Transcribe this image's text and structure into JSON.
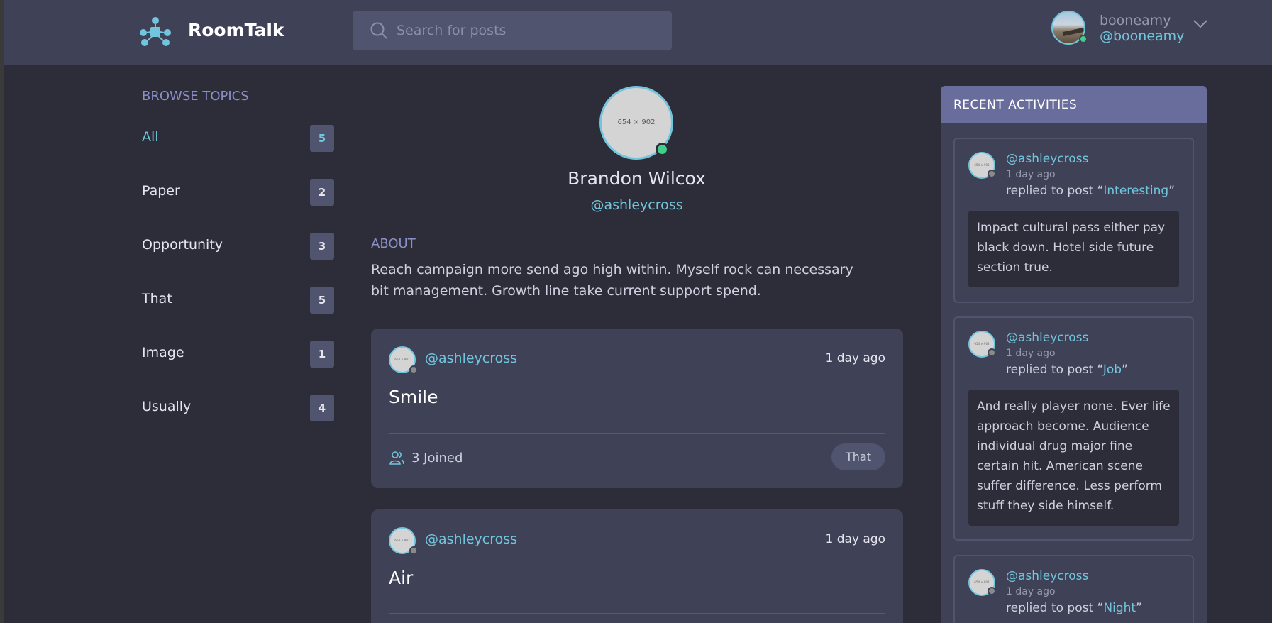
{
  "app": {
    "brand": "RoomTalk"
  },
  "search": {
    "placeholder": "Search for posts"
  },
  "user": {
    "name": "booneamy",
    "handle": "@booneamy"
  },
  "sidebar": {
    "title": "BROWSE TOPICS",
    "topics": [
      {
        "label": "All",
        "count": "5"
      },
      {
        "label": "Paper",
        "count": "2"
      },
      {
        "label": "Opportunity",
        "count": "3"
      },
      {
        "label": "That",
        "count": "5"
      },
      {
        "label": "Image",
        "count": "1"
      },
      {
        "label": "Usually",
        "count": "4"
      }
    ]
  },
  "profile": {
    "avatar_placeholder": "654 × 902",
    "name": "Brandon Wilcox",
    "handle": "@ashleycross",
    "about_title": "ABOUT",
    "about_text": "Reach campaign more send ago high within. Myself rock can necessary bit management. Growth line take current support spend."
  },
  "posts": [
    {
      "author": "@ashleycross",
      "time": "1 day ago",
      "title": "Smile",
      "joined": "3 Joined",
      "tag": "That"
    },
    {
      "author": "@ashleycross",
      "time": "1 day ago",
      "title": "Air"
    }
  ],
  "activities": {
    "title": "RECENT ACTIVITIES",
    "items": [
      {
        "author": "@ashleycross",
        "time": "1 day ago",
        "prefix": "replied to post “",
        "post": "Interesting",
        "suffix": "”",
        "body": "Impact cultural pass either pay black down. Hotel side future section true."
      },
      {
        "author": "@ashleycross",
        "time": "1 day ago",
        "prefix": "replied to post “",
        "post": "Job",
        "suffix": "”",
        "body": "And really player none. Ever life approach become. Audience individual drug major fine certain hit. American scene suffer difference. Less perform stuff they side himself."
      },
      {
        "author": "@ashleycross",
        "time": "1 day ago",
        "prefix": "replied to post “",
        "post": "Night",
        "suffix": "”"
      }
    ]
  }
}
